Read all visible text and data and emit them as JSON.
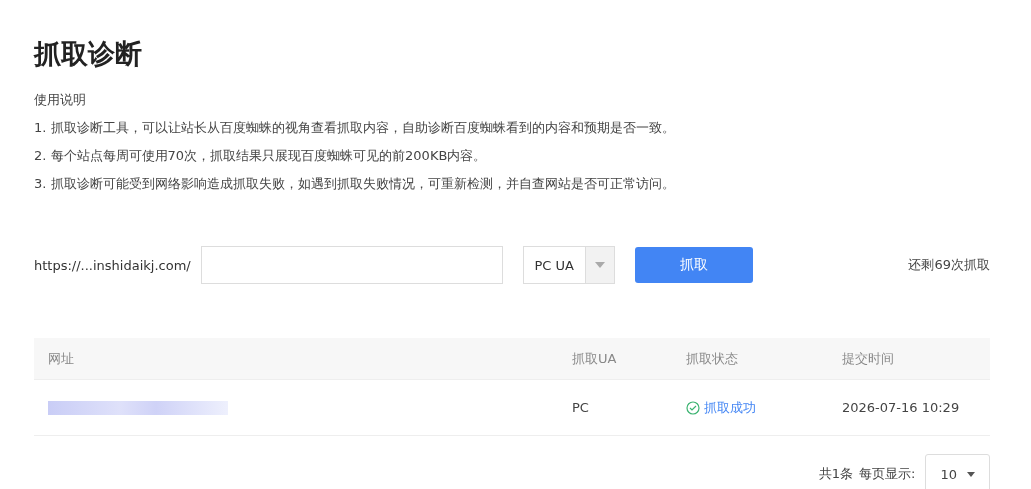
{
  "title": "抓取诊断",
  "instructions": {
    "heading": "使用说明",
    "items": [
      "1. 抓取诊断工具，可以让站长从百度蜘蛛的视角查看抓取内容，自助诊断百度蜘蛛看到的内容和预期是否一致。",
      "2. 每个站点每周可使用70次，抓取结果只展现百度蜘蛛可见的前200KB内容。",
      "3. 抓取诊断可能受到网络影响造成抓取失败，如遇到抓取失败情况，可重新检测，并自查网站是否可正常访问。"
    ]
  },
  "form": {
    "site_prefix": "https://...inshidaikj.com/",
    "ua_select": "PC UA",
    "submit": "抓取",
    "remaining": "还剩69次抓取"
  },
  "table": {
    "columns": [
      "网址",
      "抓取UA",
      "抓取状态",
      "提交时间"
    ],
    "rows": [
      {
        "ua": "PC",
        "status": "抓取成功",
        "kind": "success",
        "time": "2026-07-16 10:29"
      }
    ]
  },
  "pagination": {
    "total": "共1条",
    "page_size_label": "每页显示:",
    "page_size": "10"
  }
}
